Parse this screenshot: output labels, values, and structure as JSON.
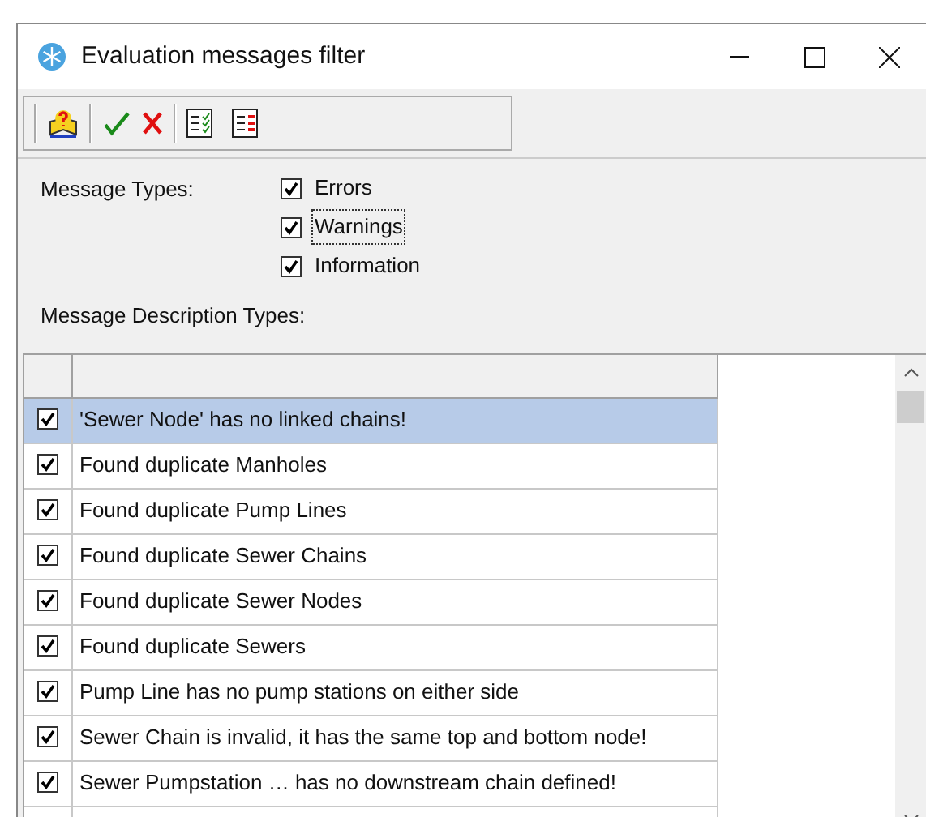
{
  "window": {
    "title": "Evaluation messages filter"
  },
  "message_types": {
    "label": "Message Types:",
    "options": [
      {
        "label": "Errors",
        "checked": true,
        "focused": false
      },
      {
        "label": "Warnings",
        "checked": true,
        "focused": true
      },
      {
        "label": "Information",
        "checked": true,
        "focused": false
      }
    ]
  },
  "description_types": {
    "label": "Message Description Types:",
    "rows": [
      {
        "text": "'Sewer Node' has no linked chains!",
        "checked": true,
        "selected": true
      },
      {
        "text": "Found duplicate Manholes",
        "checked": true,
        "selected": false
      },
      {
        "text": "Found duplicate Pump Lines",
        "checked": true,
        "selected": false
      },
      {
        "text": "Found duplicate Sewer Chains",
        "checked": true,
        "selected": false
      },
      {
        "text": "Found duplicate Sewer Nodes",
        "checked": true,
        "selected": false
      },
      {
        "text": "Found duplicate Sewers",
        "checked": true,
        "selected": false
      },
      {
        "text": "Pump Line has no pump stations on either side",
        "checked": true,
        "selected": false
      },
      {
        "text": "Sewer Chain is invalid, it has the same top and bottom node!",
        "checked": true,
        "selected": false
      },
      {
        "text": "Sewer Pumpstation … has no downstream chain defined!",
        "checked": true,
        "selected": false
      }
    ]
  }
}
